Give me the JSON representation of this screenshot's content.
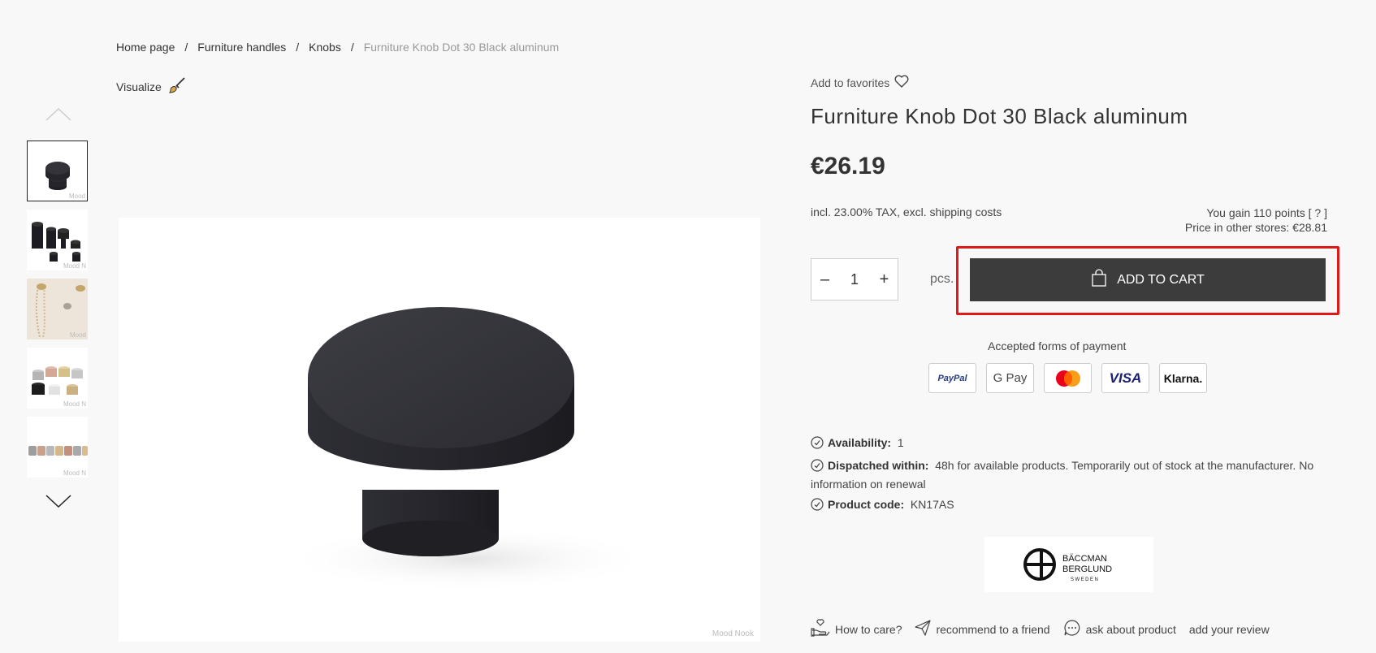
{
  "breadcrumb": {
    "items": [
      "Home page",
      "Furniture handles",
      "Knobs"
    ],
    "separator": "/",
    "current": "Furniture Knob Dot 30 Black aluminum"
  },
  "visualize_label": "Visualize",
  "gallery": {
    "thumbnails": [
      {
        "label": "Mood",
        "alt": "black knob front view"
      },
      {
        "label": "Mood N",
        "alt": "black knobs set"
      },
      {
        "label": "Mood",
        "alt": "knobs on wall with jewelry"
      },
      {
        "label": "Mood N",
        "alt": "knobs in various finishes"
      },
      {
        "label": "Mood N",
        "alt": "row of knobs"
      }
    ],
    "main_watermark": "Mood Nook"
  },
  "product": {
    "favorites_label": "Add to favorites",
    "title": "Furniture Knob Dot 30 Black aluminum",
    "price": "€26.19",
    "tax_note": "incl. 23.00% TAX, excl. shipping costs",
    "points": "You gain 110 points [ ? ]",
    "other_stores": "Price in other stores:  €28.81",
    "quantity": "1",
    "quantity_unit": "pcs.",
    "add_to_cart": "ADD TO CART"
  },
  "payments": {
    "label": "Accepted forms of payment",
    "methods": [
      "PayPal",
      "G Pay",
      "Mastercard",
      "VISA",
      "Klarna."
    ]
  },
  "details": {
    "availability_label": "Availability:",
    "availability_value": "1",
    "dispatch_label": "Dispatched within:",
    "dispatch_value": "48h for available products. Temporarily out of stock at the manufacturer. No information on renewal",
    "code_label": "Product code:",
    "code_value": "KN17AS"
  },
  "brand": {
    "line1": "BÄCCMAN",
    "line2": "BERGLUND",
    "line3": "SWEDEN"
  },
  "actions": {
    "care": "How to care?",
    "recommend": "recommend to a friend",
    "ask": "ask about product",
    "review": "add your review"
  },
  "colors": {
    "accent_button": "#3c3c3c",
    "highlight": "#e01818",
    "background": "#f8f8f8"
  }
}
